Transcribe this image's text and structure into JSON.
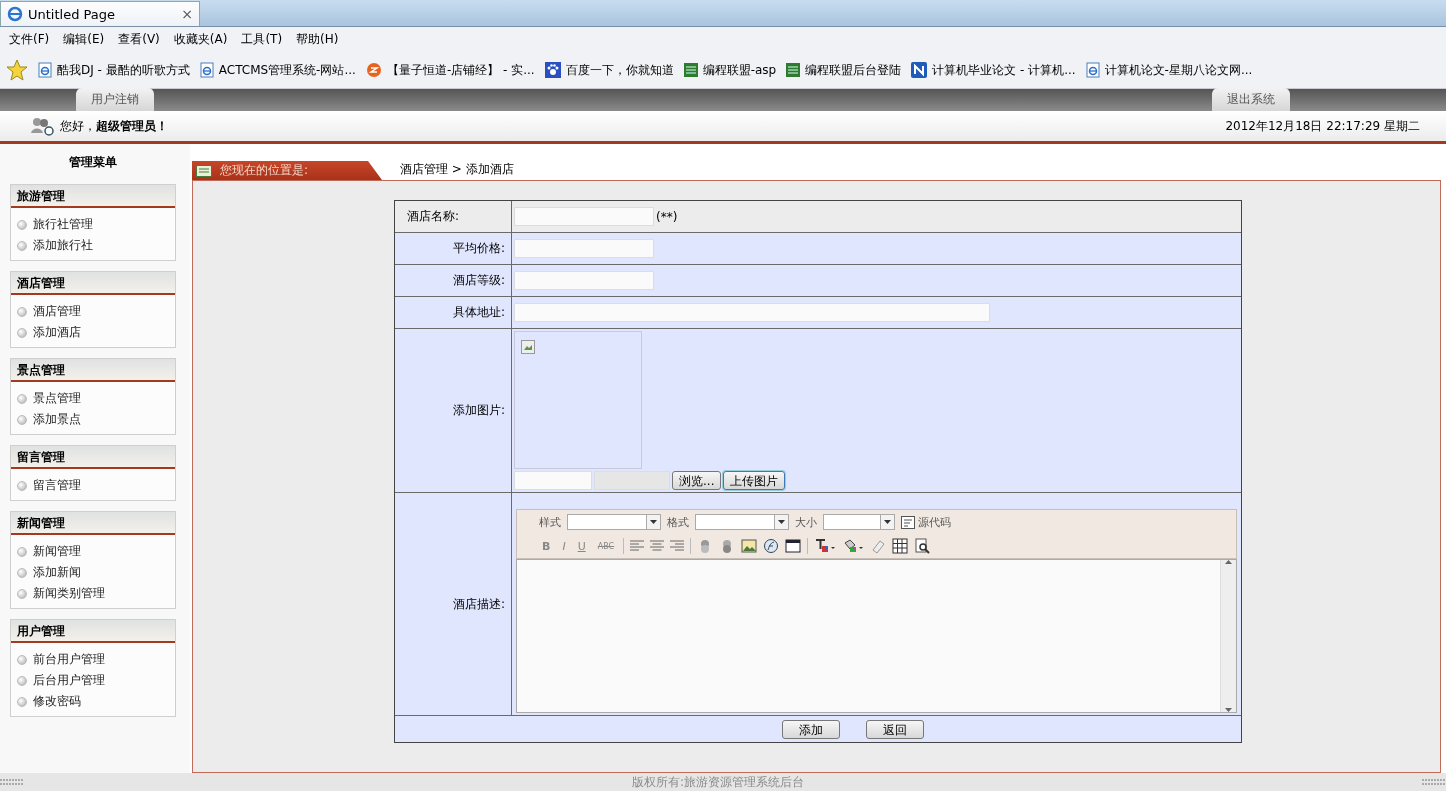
{
  "browser": {
    "tab_title": "Untitled Page",
    "close": "×"
  },
  "menu_bar": [
    "文件(F)",
    "编辑(E)",
    "查看(V)",
    "收藏夹(A)",
    "工具(T)",
    "帮助(H)"
  ],
  "favorites": [
    {
      "label": "酷我DJ - 最酷的听歌方式",
      "kind": "page"
    },
    {
      "label": "ACTCMS管理系统-网站...",
      "kind": "page"
    },
    {
      "label": "【量子恒道-店铺经】 - 实...",
      "kind": "orange"
    },
    {
      "label": "百度一下，你就知道",
      "kind": "paw"
    },
    {
      "label": "编程联盟-asp",
      "kind": "grid"
    },
    {
      "label": "编程联盟后台登陆",
      "kind": "grid"
    },
    {
      "label": "计算机毕业论文 - 计算机...",
      "kind": "blue"
    },
    {
      "label": "计算机论文-星期八论文网...",
      "kind": "page"
    }
  ],
  "header": {
    "logout_tab": "用户注销",
    "exit_tab": "退出系统",
    "greeting": "您好，**超级管理员！**",
    "datetime": "2012年12月18日 22:17:29 星期二"
  },
  "sidebar": {
    "title": "管理菜单",
    "sections": [
      {
        "title": "旅游管理",
        "items": [
          "旅行社管理",
          "添加旅行社"
        ]
      },
      {
        "title": "酒店管理",
        "items": [
          "酒店管理",
          "添加酒店"
        ]
      },
      {
        "title": "景点管理",
        "items": [
          "景点管理",
          "添加景点"
        ]
      },
      {
        "title": "留言管理",
        "items": [
          "留言管理"
        ]
      },
      {
        "title": "新闻管理",
        "items": [
          "新闻管理",
          "添加新闻",
          "新闻类别管理"
        ]
      },
      {
        "title": "用户管理",
        "items": [
          "前台用户管理",
          "后台用户管理",
          "修改密码"
        ]
      }
    ]
  },
  "breadcrumb": {
    "label": "您现在的位置是:",
    "path": "酒店管理 > 添加酒店"
  },
  "form": {
    "rows": [
      {
        "label": "酒店名称:",
        "kind": "text",
        "note": "(**)"
      },
      {
        "label": "平均价格:",
        "kind": "text"
      },
      {
        "label": "酒店等级:",
        "kind": "text"
      },
      {
        "label": "具体地址:",
        "kind": "wide"
      },
      {
        "label": "添加图片:",
        "kind": "image",
        "browse": "浏览...",
        "upload": "上传图片"
      },
      {
        "label": "酒店描述:",
        "kind": "editor"
      }
    ],
    "editor": {
      "selects": [
        "样式",
        "格式",
        "大小"
      ],
      "source": "源代码",
      "format_buttons": [
        "B",
        "I",
        "U",
        "ABC"
      ]
    },
    "buttons": [
      "添加",
      "返回"
    ]
  },
  "footer": "版权所有:旅游资源管理系统后台"
}
